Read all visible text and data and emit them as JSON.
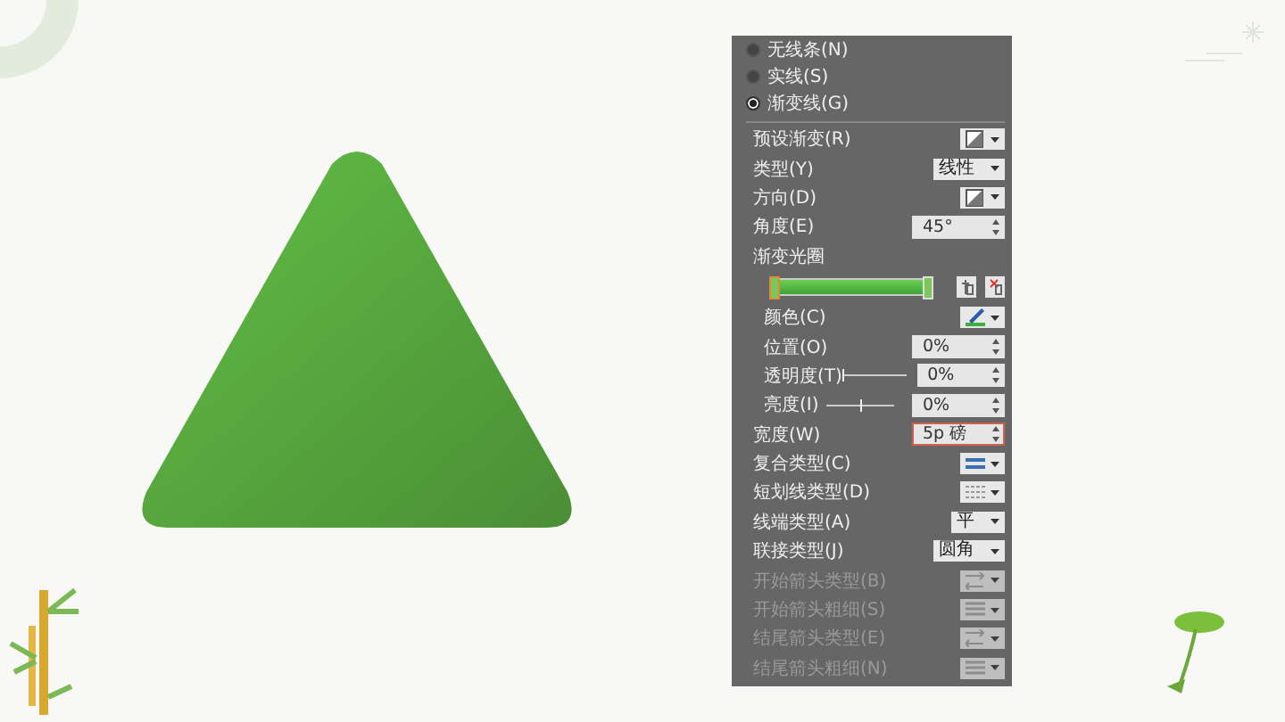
{
  "line_options": [
    {
      "label": "无线条(N)",
      "selected": false
    },
    {
      "label": "实线(S)",
      "selected": false
    },
    {
      "label": "渐变线(G)",
      "selected": true
    }
  ],
  "rows": [
    {
      "kind": "gradient-dropdown",
      "label": "预设渐变(R)"
    },
    {
      "kind": "text-dropdown",
      "label": "类型(Y)",
      "value": "线性"
    },
    {
      "kind": "gradient-dropdown",
      "label": "方向(D)"
    },
    {
      "kind": "spin",
      "label": "角度(E)",
      "value": "45°"
    },
    {
      "kind": "heading",
      "label": "渐变光圈"
    },
    {
      "kind": "gradient-stops"
    },
    {
      "kind": "pen-dropdown",
      "label": "颜色(C)",
      "indent": true
    },
    {
      "kind": "spin",
      "label": "位置(O)",
      "value": "0%",
      "indent": true
    },
    {
      "kind": "slider-spin",
      "label": "透明度(T)",
      "value": "0%",
      "level": 0,
      "indent": true
    },
    {
      "kind": "slider-spin",
      "label": "亮度(I)",
      "value": "0%",
      "level": 0.5,
      "indent": true
    },
    {
      "kind": "spin",
      "label": "宽度(W)",
      "value": "5p 磅",
      "focused": true
    },
    {
      "kind": "compound-dropdown",
      "label": "复合类型(C)"
    },
    {
      "kind": "dash-dropdown",
      "label": "短划线类型(D)"
    },
    {
      "kind": "text-dropdown",
      "label": "线端类型(A)",
      "value": "平"
    },
    {
      "kind": "text-dropdown",
      "label": "联接类型(J)",
      "value": "圆角"
    },
    {
      "kind": "arrows-dropdown",
      "label": "开始箭头类型(B)",
      "disabled": true
    },
    {
      "kind": "lines-dropdown",
      "label": "开始箭头粗细(S)",
      "disabled": true
    },
    {
      "kind": "arrows-dropdown",
      "label": "结尾箭头类型(E)",
      "disabled": true
    },
    {
      "kind": "lines-dropdown",
      "label": "结尾箭头粗细(N)",
      "disabled": true
    }
  ]
}
